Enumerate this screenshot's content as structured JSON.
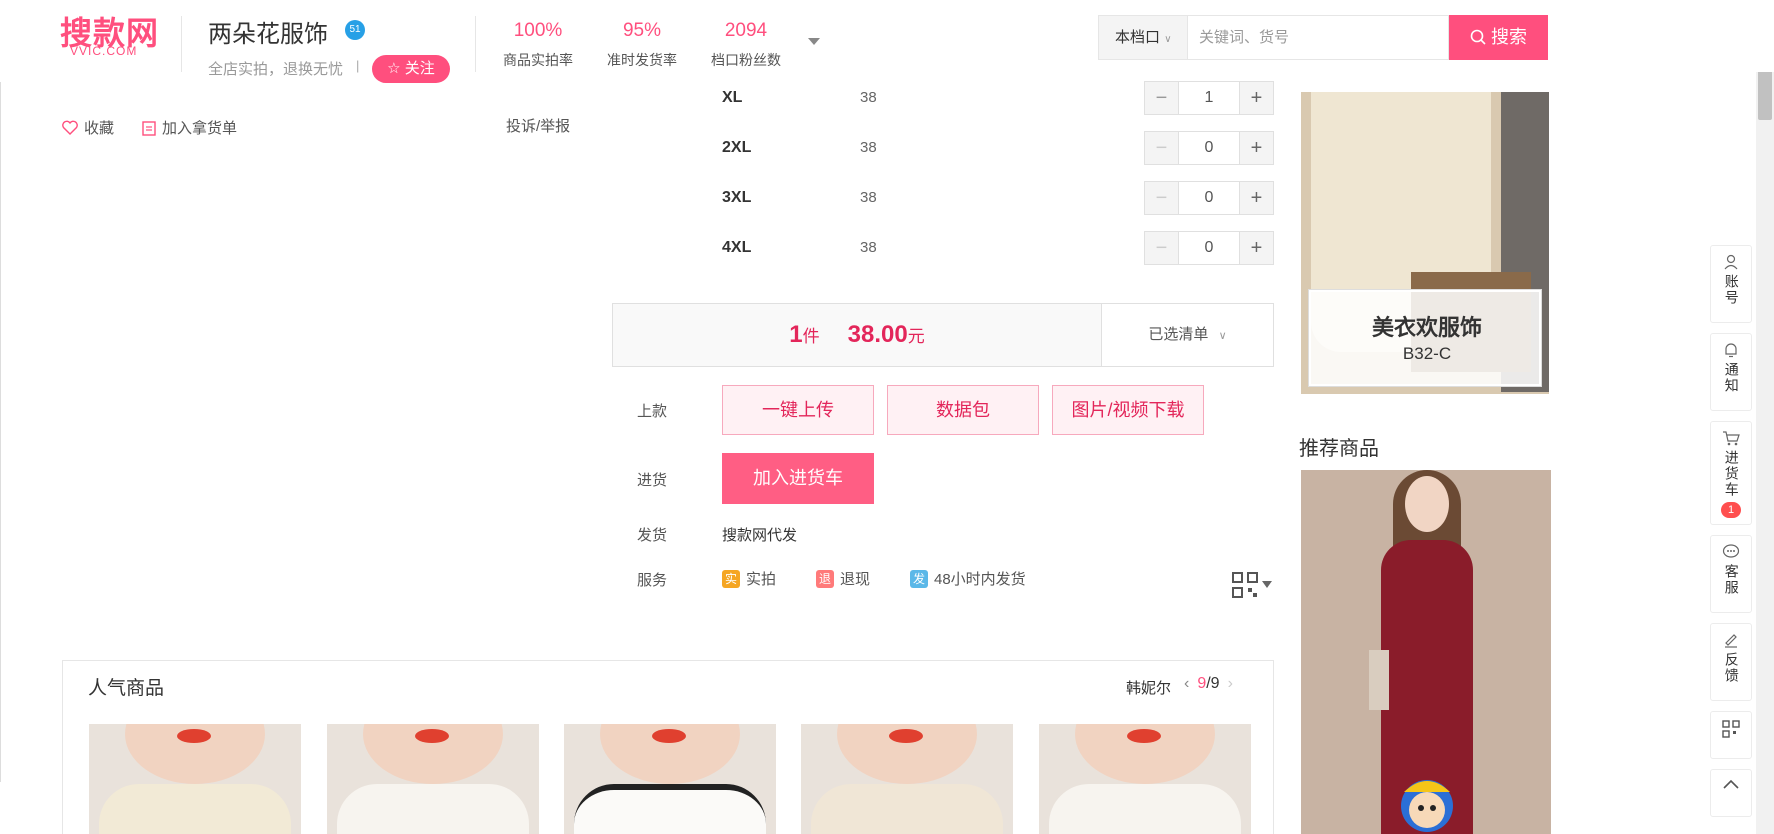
{
  "header": {
    "logo": "搜款网",
    "logo_sub": "VVIC.COM",
    "shop_name": "两朵花服饰",
    "shop_badge": "51",
    "slogan": "全店实拍，退换无忧",
    "slogan_sep": "|",
    "follow_label": "关注",
    "stats": [
      {
        "value": "100%",
        "label": "商品实拍率"
      },
      {
        "value": "95%",
        "label": "准时发货率"
      },
      {
        "value": "2094",
        "label": "档口粉丝数"
      }
    ],
    "search": {
      "scope": "本档口",
      "placeholder": "关键词、货号",
      "button": "搜索"
    }
  },
  "left_actions": {
    "favorite": "收藏",
    "add_to_list": "加入拿货单",
    "report": "投诉/举报"
  },
  "sizes": [
    {
      "name": "XL",
      "stock": "38",
      "qty": "1"
    },
    {
      "name": "2XL",
      "stock": "38",
      "qty": "0"
    },
    {
      "name": "3XL",
      "stock": "38",
      "qty": "0"
    },
    {
      "name": "4XL",
      "stock": "38",
      "qty": "0"
    }
  ],
  "summary": {
    "count": "1",
    "count_unit": "件",
    "price": "38.00",
    "price_unit": "元",
    "selected_list": "已选清单"
  },
  "actions": {
    "upload_label": "上款",
    "one_click_upload": "一键上传",
    "data_package": "数据包",
    "media_download": "图片/视频下载",
    "purchase_label": "进货",
    "add_to_cart": "加入进货车",
    "shipping_label": "发货",
    "shipping_value": "搜款网代发",
    "service_label": "服务",
    "services": [
      {
        "icon": "实",
        "text": "实拍",
        "color": "#f5a623"
      },
      {
        "icon": "退",
        "text": "退现",
        "color": "#ff7a7a"
      },
      {
        "icon": "发",
        "text": "48小时内发货",
        "color": "#5bb8e8"
      }
    ]
  },
  "popular": {
    "title": "人气商品",
    "shop": "韩妮尔",
    "page_current": "9",
    "page_total": "/9"
  },
  "shop_card": {
    "name": "美衣欢服饰",
    "code": "B32-C"
  },
  "recommend": {
    "title": "推荐商品"
  },
  "toolbar": {
    "account": "账号",
    "notify": "通知",
    "cart": "进货车",
    "cart_count": "1",
    "service": "客服",
    "feedback": "反馈"
  },
  "colors": {
    "brand": "#ff4f7e",
    "price": "#e3265a"
  }
}
